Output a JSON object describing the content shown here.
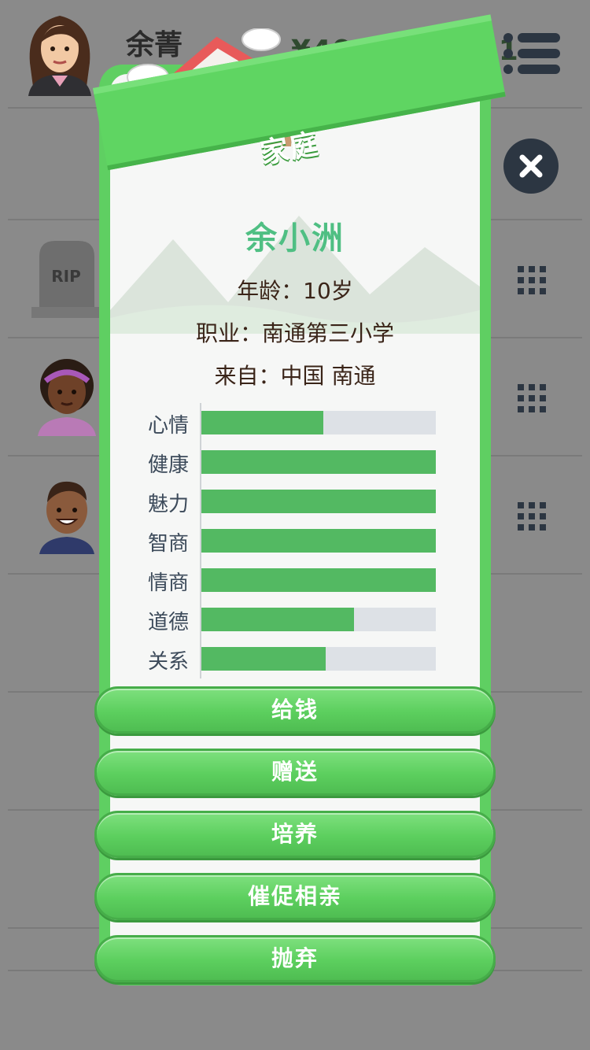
{
  "header": {
    "player_name": "余菁",
    "money": "¥402.452.241"
  },
  "background_rows": {
    "grave_text": "RIP"
  },
  "popup": {
    "title": "家庭",
    "member_name": "余小洲",
    "age_line": "年龄：10岁",
    "job_line": "职业：南通第三小学",
    "origin_line": "来自：中国 南通",
    "stats": [
      {
        "label": "心情",
        "value": 0.52
      },
      {
        "label": "健康",
        "value": 1.0
      },
      {
        "label": "魅力",
        "value": 1.0
      },
      {
        "label": "智商",
        "value": 1.0
      },
      {
        "label": "情商",
        "value": 1.0
      },
      {
        "label": "道德",
        "value": 0.65
      },
      {
        "label": "关系",
        "value": 0.53
      }
    ],
    "actions": [
      "给钱",
      "赠送",
      "培养",
      "催促相亲",
      "抛弃"
    ]
  },
  "colors": {
    "accent_green": "#5fcf62",
    "bar_fill": "#53b962",
    "bar_track": "#dde1e6",
    "name_color": "#4fbf83"
  },
  "icons": {
    "menu": "menu-icon",
    "close": "close-icon",
    "row_menu": "grid-menu-icon",
    "house": "house-icon"
  }
}
